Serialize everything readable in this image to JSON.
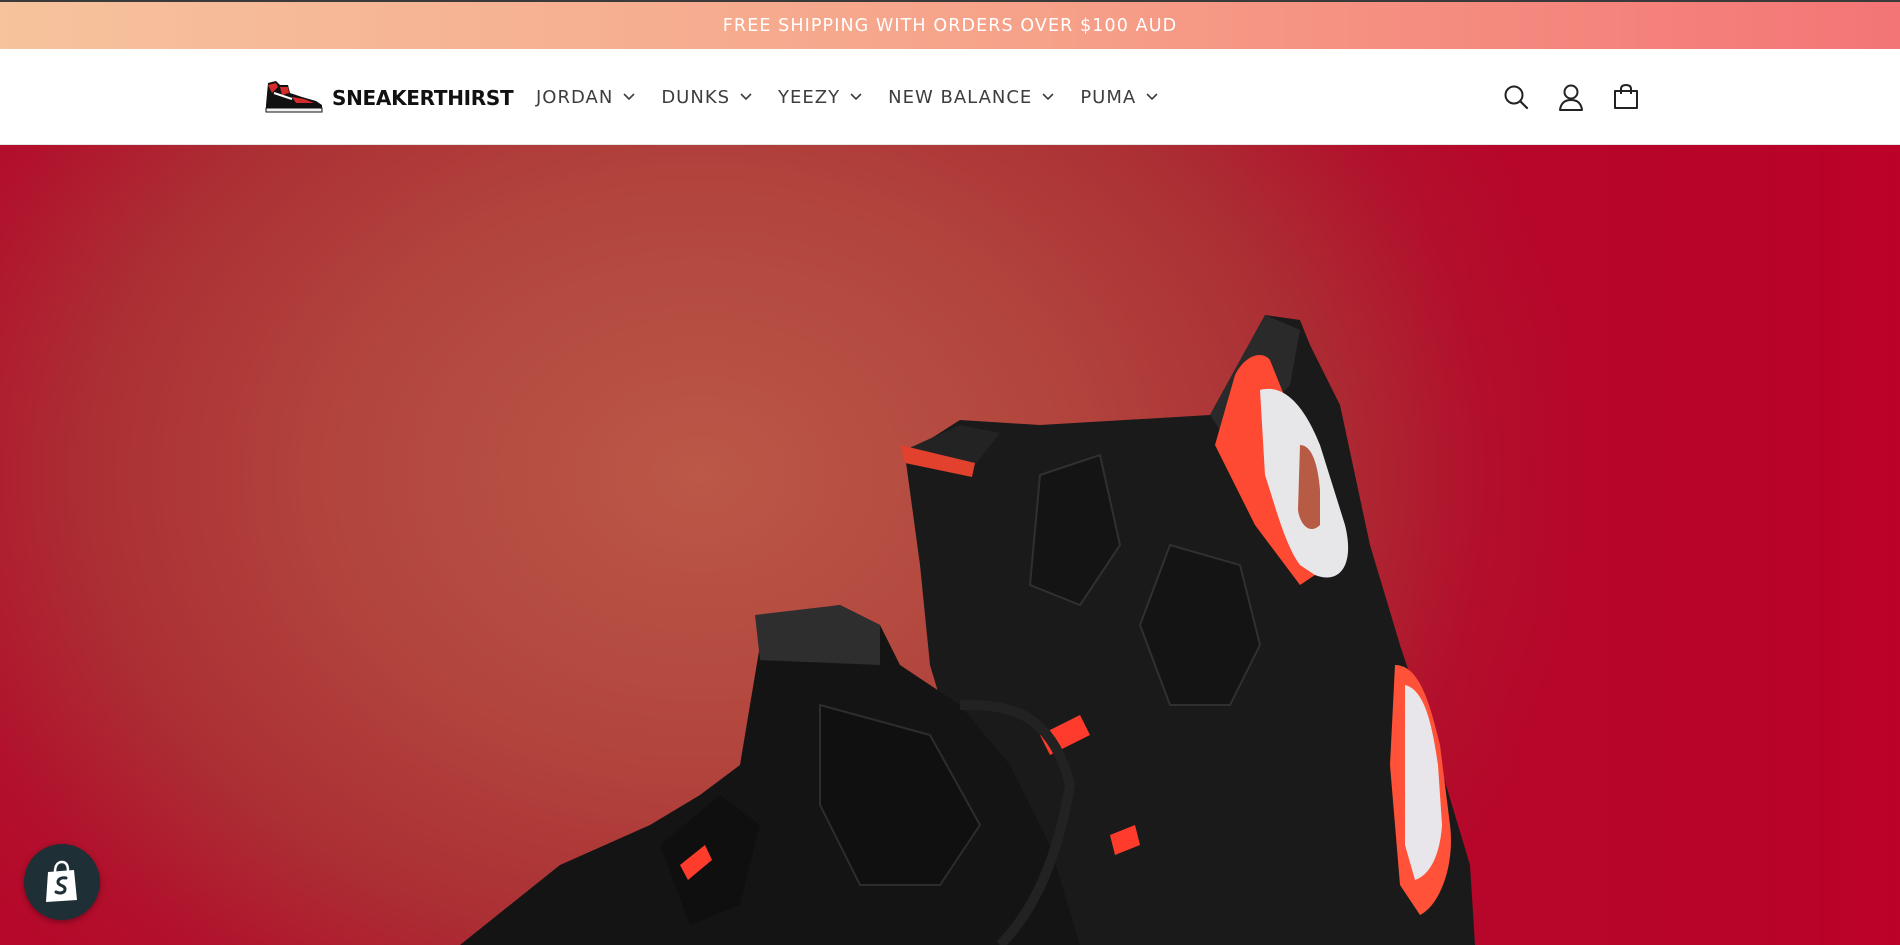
{
  "announcement": {
    "text": "FREE SHIPPING WITH ORDERS OVER $100 AUD"
  },
  "header": {
    "logo_text": "SNEAKERTHIRST",
    "nav": [
      {
        "label": "JORDAN"
      },
      {
        "label": "DUNKS"
      },
      {
        "label": "YEEZY"
      },
      {
        "label": "NEW BALANCE"
      },
      {
        "label": "PUMA"
      }
    ],
    "icons": [
      "search-icon",
      "account-icon",
      "cart-icon"
    ]
  },
  "hero": {
    "image": "black-red-sneakers-photo"
  },
  "widget": {
    "icon": "shopify-bag-icon"
  },
  "colors": {
    "announcement_start": "#f6c39d",
    "announcement_end": "#f37575",
    "hero_red": "#b2453d"
  }
}
